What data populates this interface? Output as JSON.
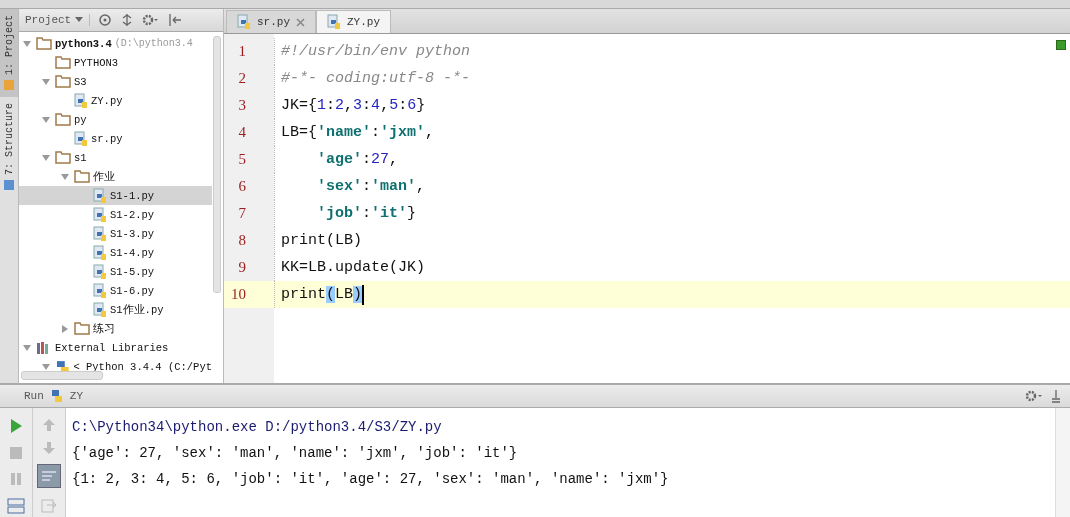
{
  "tool_strip": [
    {
      "label": "1: Project",
      "selected": true
    },
    {
      "label": "7: Structure",
      "selected": false
    }
  ],
  "project_panel": {
    "title": "Project",
    "tree": [
      {
        "kind": "project",
        "label": "python3.4",
        "hint": "(D:\\python3.4",
        "expanded": true,
        "children": [
          {
            "kind": "folder",
            "label": "PYTHON3"
          },
          {
            "kind": "folder",
            "label": "S3",
            "expanded": true,
            "children": [
              {
                "kind": "file",
                "label": "ZY.py",
                "selected": false
              }
            ]
          },
          {
            "kind": "folder",
            "label": "py",
            "expanded": true,
            "children": [
              {
                "kind": "file",
                "label": "sr.py",
                "selected": false
              }
            ]
          },
          {
            "kind": "folder",
            "label": "s1",
            "expanded": true,
            "children": [
              {
                "kind": "folder",
                "label": "作业",
                "expanded": true,
                "children": [
                  {
                    "kind": "file",
                    "label": "S1-1.py",
                    "selected": true
                  },
                  {
                    "kind": "file",
                    "label": "S1-2.py",
                    "selected": false
                  },
                  {
                    "kind": "file",
                    "label": "S1-3.py",
                    "selected": false
                  },
                  {
                    "kind": "file",
                    "label": "S1-4.py",
                    "selected": false
                  },
                  {
                    "kind": "file",
                    "label": "S1-5.py",
                    "selected": false
                  },
                  {
                    "kind": "file",
                    "label": "S1-6.py",
                    "selected": false
                  },
                  {
                    "kind": "file",
                    "label": "S1作业.py",
                    "selected": false
                  }
                ]
              },
              {
                "kind": "folder",
                "label": "练习",
                "expanded": false
              }
            ]
          }
        ]
      },
      {
        "kind": "library",
        "label": "External Libraries",
        "expanded": true,
        "children": [
          {
            "kind": "sdk",
            "label": "< Python 3.4.4 (C:/Pyt",
            "expanded": true
          }
        ]
      }
    ]
  },
  "editor": {
    "tabs": [
      {
        "label": "sr.py",
        "selected": false,
        "closable": true
      },
      {
        "label": "ZY.py",
        "selected": true,
        "closable": false
      }
    ],
    "lines": [
      {
        "number": "1",
        "current": false,
        "indented": false,
        "tokens": [
          {
            "kind": "comment",
            "text": "#!/usr/bin/env python"
          }
        ]
      },
      {
        "number": "2",
        "current": false,
        "indented": false,
        "tokens": [
          {
            "kind": "comment",
            "text": "#-*- coding:utf-8 -*-"
          }
        ]
      },
      {
        "number": "3",
        "current": false,
        "indented": false,
        "tokens": [
          {
            "kind": "plain",
            "text": "JK={"
          },
          {
            "kind": "number",
            "text": "1"
          },
          {
            "kind": "plain",
            "text": ":"
          },
          {
            "kind": "number",
            "text": "2"
          },
          {
            "kind": "plain",
            "text": ","
          },
          {
            "kind": "number",
            "text": "3"
          },
          {
            "kind": "plain",
            "text": ":"
          },
          {
            "kind": "number",
            "text": "4"
          },
          {
            "kind": "plain",
            "text": ","
          },
          {
            "kind": "number",
            "text": "5"
          },
          {
            "kind": "plain",
            "text": ":"
          },
          {
            "kind": "number",
            "text": "6"
          },
          {
            "kind": "plain",
            "text": "}"
          }
        ]
      },
      {
        "number": "4",
        "current": false,
        "indented": false,
        "tokens": [
          {
            "kind": "plain",
            "text": "LB={"
          },
          {
            "kind": "string",
            "text": "'name'"
          },
          {
            "kind": "plain",
            "text": ":"
          },
          {
            "kind": "string",
            "text": "'jxm'"
          },
          {
            "kind": "plain",
            "text": ","
          }
        ]
      },
      {
        "number": "5",
        "current": false,
        "indented": true,
        "tokens": [
          {
            "kind": "string",
            "text": "'age'"
          },
          {
            "kind": "plain",
            "text": ":"
          },
          {
            "kind": "number",
            "text": "27"
          },
          {
            "kind": "plain",
            "text": ","
          }
        ]
      },
      {
        "number": "6",
        "current": false,
        "indented": true,
        "tokens": [
          {
            "kind": "string",
            "text": "'sex'"
          },
          {
            "kind": "plain",
            "text": ":"
          },
          {
            "kind": "string",
            "text": "'man'"
          },
          {
            "kind": "plain",
            "text": ","
          }
        ]
      },
      {
        "number": "7",
        "current": false,
        "indented": true,
        "tokens": [
          {
            "kind": "string",
            "text": "'job'"
          },
          {
            "kind": "plain",
            "text": ":"
          },
          {
            "kind": "string",
            "text": "'it'"
          },
          {
            "kind": "plain",
            "text": "}"
          }
        ]
      },
      {
        "number": "8",
        "current": false,
        "indented": false,
        "tokens": [
          {
            "kind": "plain",
            "text": "print(LB)"
          }
        ]
      },
      {
        "number": "9",
        "current": false,
        "indented": false,
        "tokens": [
          {
            "kind": "plain",
            "text": "KK=LB.update(JK)"
          }
        ]
      },
      {
        "number": "10",
        "current": true,
        "indented": false,
        "tokens": [
          {
            "kind": "plain",
            "text": "print"
          },
          {
            "kind": "matched",
            "text": "("
          },
          {
            "kind": "plain",
            "text": "LB"
          },
          {
            "kind": "matched",
            "text": ")"
          }
        ]
      }
    ]
  },
  "run_panel": {
    "title": "Run",
    "config": "ZY",
    "output": [
      {
        "kind": "command",
        "text": "C:\\Python34\\python.exe D:/python3.4/S3/ZY.py"
      },
      {
        "kind": "output",
        "text": "{'age': 27, 'sex': 'man', 'name': 'jxm', 'job': 'it'}"
      },
      {
        "kind": "output",
        "text": "{1: 2, 3: 4, 5: 6, 'job': 'it', 'age': 27, 'sex': 'man', 'name': 'jxm'}"
      }
    ]
  }
}
